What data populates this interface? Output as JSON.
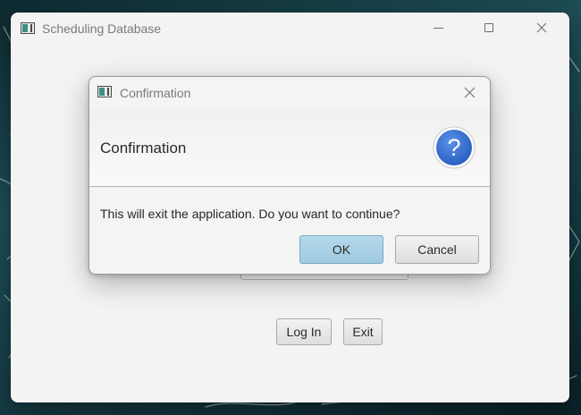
{
  "main_window": {
    "title": "Scheduling Database",
    "controls": {
      "minimize": "minimize-icon",
      "maximize": "maximize-icon",
      "close": "close-icon"
    },
    "buttons": {
      "login_label": "Log In",
      "exit_label": "Exit"
    }
  },
  "dialog": {
    "title": "Confirmation",
    "header_text": "Confirmation",
    "icon": "question-icon",
    "icon_glyph": "?",
    "message": "This will exit the application. Do you want to continue?",
    "buttons": {
      "ok_label": "OK",
      "cancel_label": "Cancel"
    }
  },
  "colors": {
    "window_bg": "#f3f3f3",
    "ok_button_bg": "#a7d0e6",
    "question_icon_blue": "#2f6fd0"
  }
}
